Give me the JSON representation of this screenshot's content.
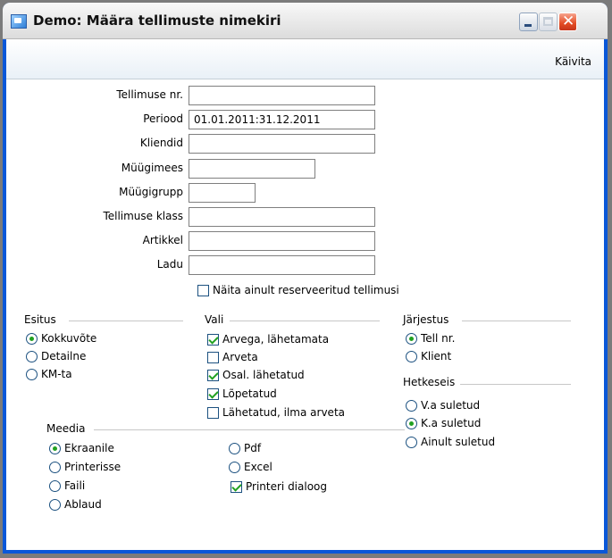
{
  "window": {
    "title": "Demo: Määra tellimuste nimekiri"
  },
  "toolbar": {
    "run_label": "Käivita"
  },
  "fields": [
    {
      "label": "Tellimuse nr.",
      "value": ""
    },
    {
      "label": "Periood",
      "value": "01.01.2011:31.12.2011"
    },
    {
      "label": "Kliendid",
      "value": ""
    },
    {
      "label": "Müügimees",
      "value": ""
    },
    {
      "label": "Müügigrupp",
      "value": ""
    },
    {
      "label": "Tellimuse klass",
      "value": ""
    },
    {
      "label": "Artikkel",
      "value": ""
    },
    {
      "label": "Ladu",
      "value": ""
    }
  ],
  "only_reserved": {
    "label": "Näita ainult reserveeritud tellimusi",
    "checked": false
  },
  "esitus": {
    "title": "Esitus",
    "options": [
      {
        "label": "Kokkuvõte",
        "selected": true
      },
      {
        "label": "Detailne",
        "selected": false
      },
      {
        "label": "KM-ta",
        "selected": false
      }
    ]
  },
  "vali": {
    "title": "Vali",
    "options": [
      {
        "label": "Arvega, lähetamata",
        "checked": true
      },
      {
        "label": "Arveta",
        "checked": false
      },
      {
        "label": "Osal. lähetatud",
        "checked": true
      },
      {
        "label": "Lõpetatud",
        "checked": true
      },
      {
        "label": "Lähetatud, ilma arveta",
        "checked": false
      }
    ]
  },
  "jarjestus": {
    "title": "Järjestus",
    "options": [
      {
        "label": "Tell nr.",
        "selected": true
      },
      {
        "label": "Klient",
        "selected": false
      }
    ]
  },
  "hetkeseis": {
    "title": "Hetkeseis",
    "options": [
      {
        "label": "V.a suletud",
        "selected": false
      },
      {
        "label": "K.a suletud",
        "selected": true
      },
      {
        "label": "Ainult suletud",
        "selected": false
      }
    ]
  },
  "meedia": {
    "title": "Meedia",
    "options": [
      {
        "label": "Ekraanile",
        "selected": true
      },
      {
        "label": "Printerisse",
        "selected": false
      },
      {
        "label": "Faili",
        "selected": false
      },
      {
        "label": "Ablaud",
        "selected": false
      },
      {
        "label": "Pdf",
        "selected": false
      },
      {
        "label": "Excel",
        "selected": false
      }
    ],
    "printer_dialog": {
      "label": "Printeri dialoog",
      "checked": true
    }
  }
}
